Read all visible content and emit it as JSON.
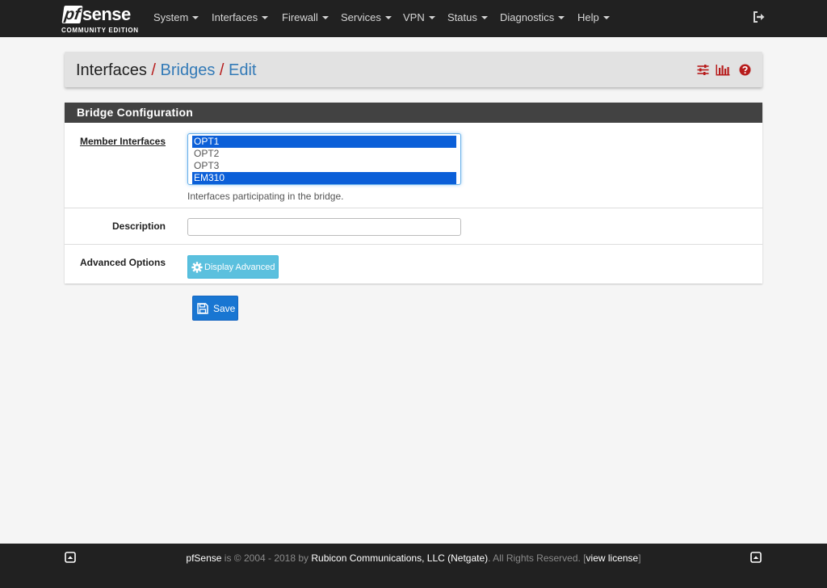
{
  "brand": {
    "prefix": "pf",
    "name": "sense",
    "edition": "COMMUNITY EDITION"
  },
  "nav": {
    "items": [
      "System",
      "Interfaces",
      "Firewall",
      "Services",
      "VPN",
      "Status",
      "Diagnostics",
      "Help"
    ]
  },
  "breadcrumb": {
    "items": [
      "Interfaces",
      "Bridges",
      "Edit"
    ],
    "separator": "/"
  },
  "panel": {
    "title": "Bridge Configuration",
    "member_label": "Member Interfaces",
    "member_options": [
      {
        "label": "OPT1",
        "selected": true
      },
      {
        "label": "OPT2",
        "selected": false
      },
      {
        "label": "OPT3",
        "selected": false
      },
      {
        "label": "EM310",
        "selected": true
      }
    ],
    "member_help": "Interfaces participating in the bridge.",
    "description_label": "Description",
    "description_value": "",
    "advanced_label": "Advanced Options",
    "advanced_button": "Display Advanced"
  },
  "save_button": "Save",
  "footer": {
    "product": "pfSense",
    "text1": " is © 2004 - 2018 by ",
    "company": "Rubicon Communications, LLC (Netgate)",
    "text2": ". All Rights Reserved. [",
    "license_link": "view license",
    "text3": "]"
  },
  "colors": {
    "navbar": "#212121",
    "accent_red": "#b71c1c",
    "link_blue": "#337ab7",
    "info_button": "#5bc0de",
    "primary_button": "#1976d2",
    "selected_option": "#0b5fd8"
  }
}
